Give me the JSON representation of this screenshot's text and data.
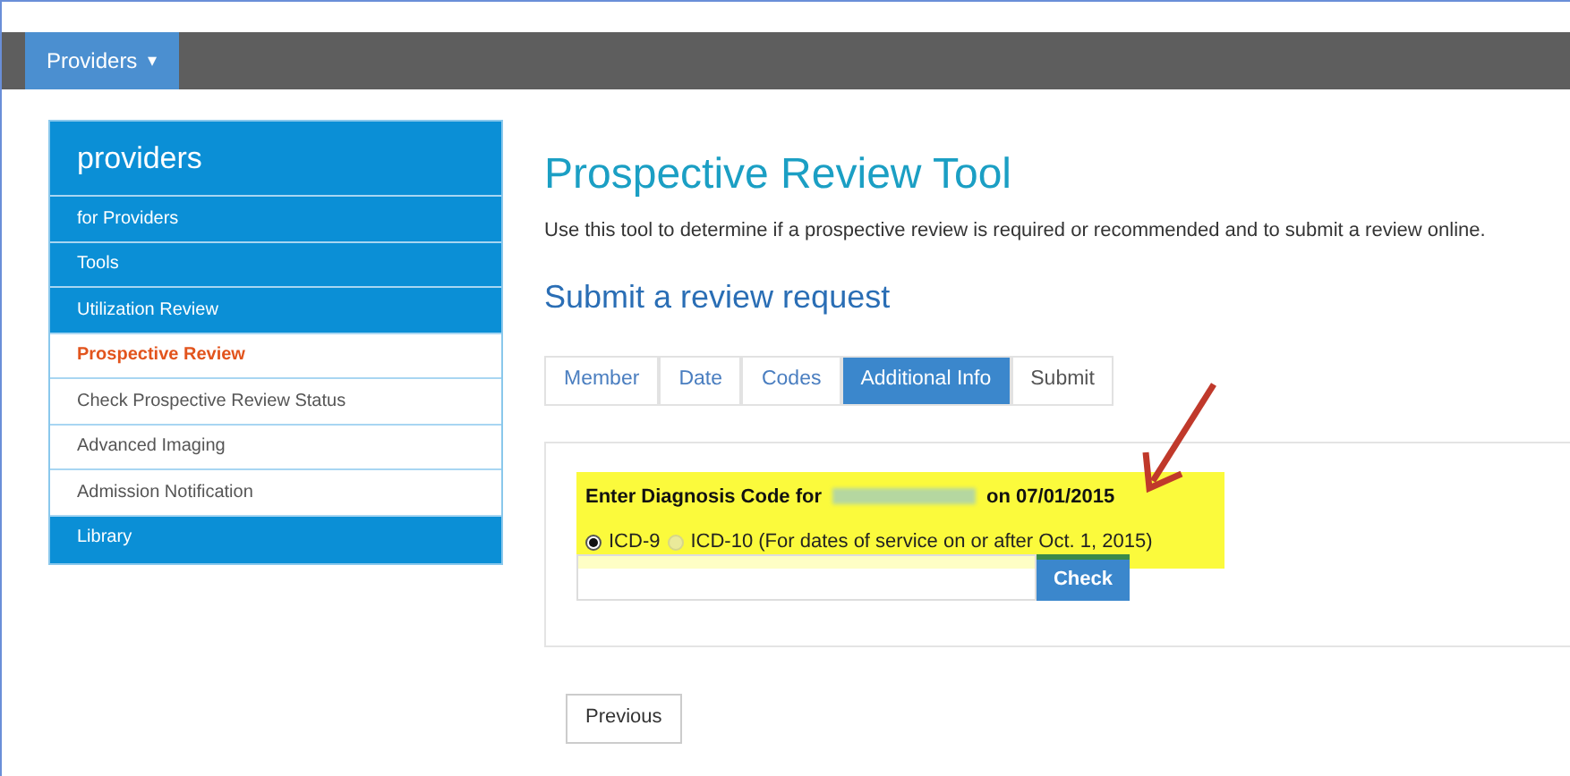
{
  "top_nav": {
    "menu": {
      "label": "Providers",
      "caret": "▾"
    }
  },
  "sidebar": {
    "title": "providers",
    "items": [
      {
        "label": "for Providers",
        "kind": "section",
        "selected": false
      },
      {
        "label": "Tools",
        "kind": "section",
        "selected": false
      },
      {
        "label": "Utilization Review",
        "kind": "section",
        "selected": false
      },
      {
        "label": "Prospective Review",
        "kind": "link",
        "selected": true
      },
      {
        "label": "Check Prospective Review Status",
        "kind": "link",
        "selected": false
      },
      {
        "label": "Advanced Imaging",
        "kind": "link",
        "selected": false
      },
      {
        "label": "Admission Notification",
        "kind": "link",
        "selected": false
      },
      {
        "label": "Library",
        "kind": "section",
        "selected": false
      }
    ]
  },
  "main": {
    "title": "Prospective Review Tool",
    "description": "Use this tool to determine if a prospective review is required or recommended and to submit a review online.",
    "subtitle": "Submit a review request",
    "tabs": [
      {
        "label": "Member",
        "selected": false
      },
      {
        "label": "Date",
        "selected": false
      },
      {
        "label": "Codes",
        "selected": false
      },
      {
        "label": "Additional Info",
        "selected": true
      },
      {
        "label": "Submit",
        "selected": false
      }
    ],
    "form": {
      "label_before": "Enter Diagnosis Code for",
      "label_after": "on 07/01/2015",
      "options": [
        {
          "label": "ICD-9",
          "selected": true
        },
        {
          "label": "ICD-10 (For dates of service on or after Oct. 1, 2015)",
          "selected": false
        }
      ],
      "button": "Check"
    },
    "previous_button": "Previous"
  }
}
